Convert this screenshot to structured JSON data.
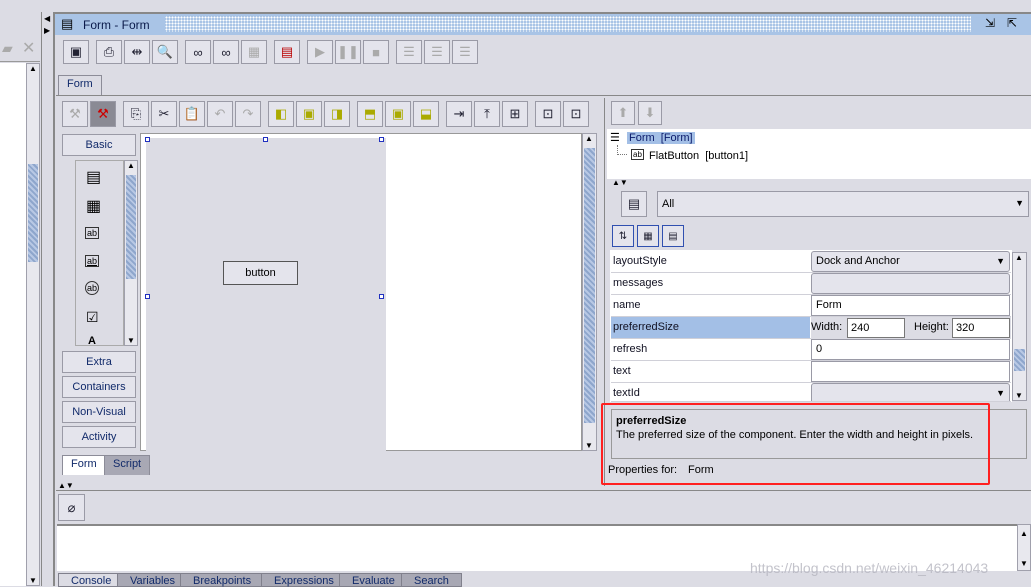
{
  "window": {
    "title": "Form - Form"
  },
  "editor_tab": "Form",
  "palette": {
    "basic": "Basic",
    "extra": "Extra",
    "containers": "Containers",
    "non_visual": "Non-Visual",
    "activity": "Activity"
  },
  "canvas": {
    "button_label": "button"
  },
  "design_tabs": [
    "Form",
    "Script"
  ],
  "tree": {
    "root": "Form  [Form]",
    "child": "FlatButton  [button1]"
  },
  "filter": {
    "value": "All"
  },
  "properties": [
    {
      "name": "layoutStyle",
      "value": "Dock and Anchor"
    },
    {
      "name": "messages",
      "value": ""
    },
    {
      "name": "name",
      "value": "Form"
    },
    {
      "name": "preferredSize",
      "width_label": "Width:",
      "width": "240",
      "height_label": "Height:",
      "height": "320"
    },
    {
      "name": "refresh",
      "value": "0"
    },
    {
      "name": "text",
      "value": ""
    },
    {
      "name": "textId",
      "value": ""
    }
  ],
  "description": {
    "title": "preferredSize",
    "text": "The preferred size of the component. Enter the width and height in pixels."
  },
  "properties_for": {
    "label": "Properties for:",
    "value": "Form"
  },
  "bottom_tabs": [
    "Console",
    "Variables",
    "Breakpoints",
    "Expressions",
    "Evaluate",
    "Search"
  ],
  "watermark": "https://blog.csdn.net/weixin_46214043",
  "colors": {
    "titlebar": "#a9c4e6",
    "selection": "#a3bfe6",
    "highlight": "#ff2020"
  }
}
